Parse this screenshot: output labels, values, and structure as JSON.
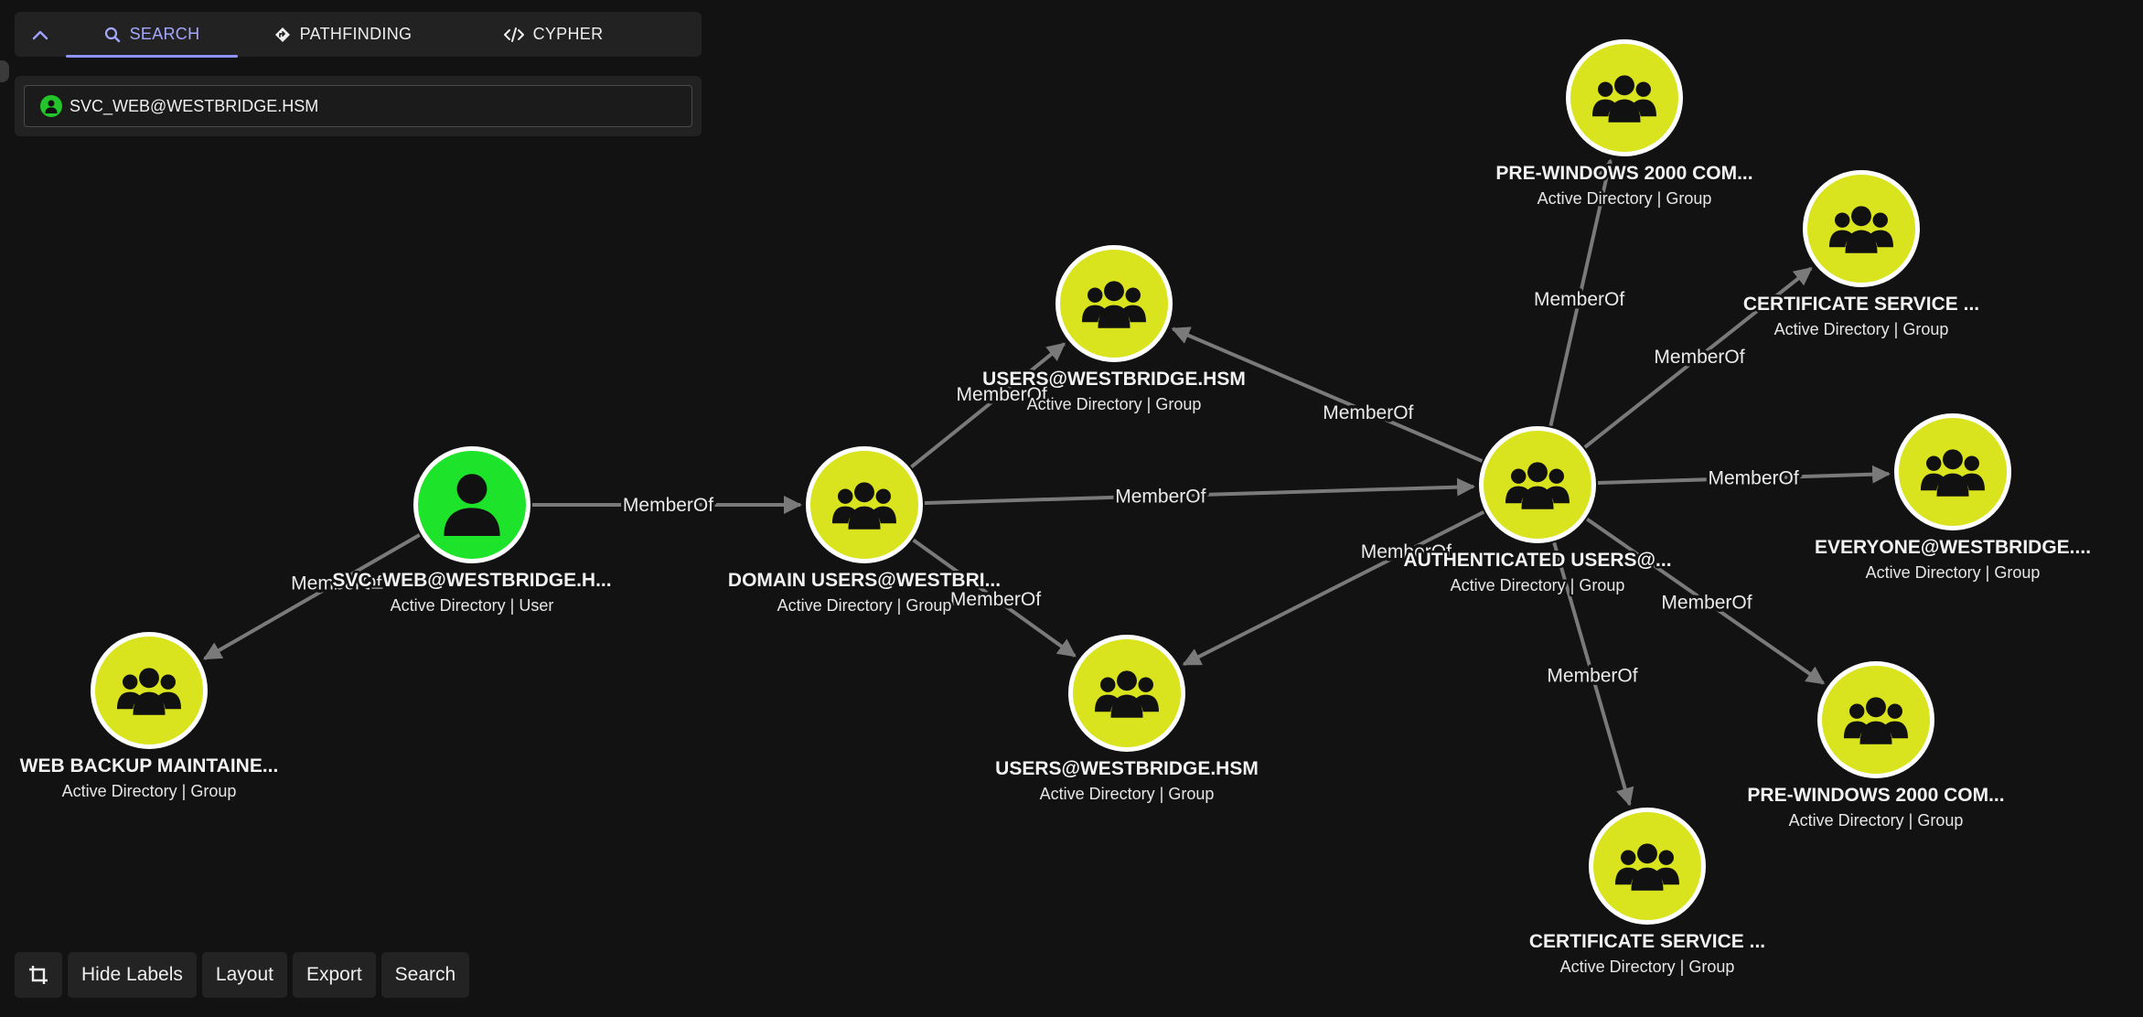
{
  "tabs": {
    "search": "SEARCH",
    "pathfinding": "PATHFINDING",
    "cypher": "CYPHER"
  },
  "search": {
    "value": "SVC_WEB@WESTBRIDGE.HSM"
  },
  "toolbar": {
    "hide_labels": "Hide Labels",
    "layout": "Layout",
    "export": "Export",
    "search": "Search"
  },
  "colors": {
    "user_node": "#1ee32b",
    "group_node": "#d9e31e",
    "edge": "#7a7a7a",
    "background": "#121212"
  },
  "graph": {
    "nodes": [
      {
        "id": "svc_web",
        "name": "SVC_WEB@WESTBRIDGE.H...",
        "sub": "Active Directory | User",
        "kind": "user"
      },
      {
        "id": "domain_users",
        "name": "DOMAIN USERS@WESTBRI...",
        "sub": "Active Directory | Group",
        "kind": "group"
      },
      {
        "id": "web_backup",
        "name": "WEB BACKUP MAINTAINE...",
        "sub": "Active Directory | Group",
        "kind": "group"
      },
      {
        "id": "users_top",
        "name": "USERS@WESTBRIDGE.HSM",
        "sub": "Active Directory | Group",
        "kind": "group"
      },
      {
        "id": "users_bottom",
        "name": "USERS@WESTBRIDGE.HSM",
        "sub": "Active Directory | Group",
        "kind": "group"
      },
      {
        "id": "auth_users",
        "name": "AUTHENTICATED USERS@...",
        "sub": "Active Directory | Group",
        "kind": "group"
      },
      {
        "id": "prewin_top",
        "name": "PRE-WINDOWS 2000 COM...",
        "sub": "Active Directory | Group",
        "kind": "group"
      },
      {
        "id": "cert_right",
        "name": "CERTIFICATE SERVICE ...",
        "sub": "Active Directory | Group",
        "kind": "group"
      },
      {
        "id": "everyone",
        "name": "EVERYONE@WESTBRIDGE....",
        "sub": "Active Directory | Group",
        "kind": "group"
      },
      {
        "id": "prewin_bottom",
        "name": "PRE-WINDOWS 2000 COM...",
        "sub": "Active Directory | Group",
        "kind": "group"
      },
      {
        "id": "cert_bottom",
        "name": "CERTIFICATE SERVICE ...",
        "sub": "Active Directory | Group",
        "kind": "group"
      }
    ],
    "edges": [
      {
        "from": "svc_web",
        "to": "domain_users",
        "label": "MemberOf"
      },
      {
        "from": "svc_web",
        "to": "web_backup",
        "label": "MemberOf"
      },
      {
        "from": "domain_users",
        "to": "users_top",
        "label": "MemberOf"
      },
      {
        "from": "domain_users",
        "to": "users_bottom",
        "label": "MemberOf"
      },
      {
        "from": "domain_users",
        "to": "auth_users",
        "label": "MemberOf"
      },
      {
        "from": "auth_users",
        "to": "users_top",
        "label": "MemberOf"
      },
      {
        "from": "auth_users",
        "to": "users_bottom",
        "label": "MemberOf"
      },
      {
        "from": "auth_users",
        "to": "prewin_top",
        "label": "MemberOf"
      },
      {
        "from": "auth_users",
        "to": "cert_right",
        "label": "MemberOf"
      },
      {
        "from": "auth_users",
        "to": "everyone",
        "label": "MemberOf"
      },
      {
        "from": "auth_users",
        "to": "prewin_bottom",
        "label": "MemberOf"
      },
      {
        "from": "auth_users",
        "to": "cert_bottom",
        "label": "MemberOf"
      }
    ]
  }
}
